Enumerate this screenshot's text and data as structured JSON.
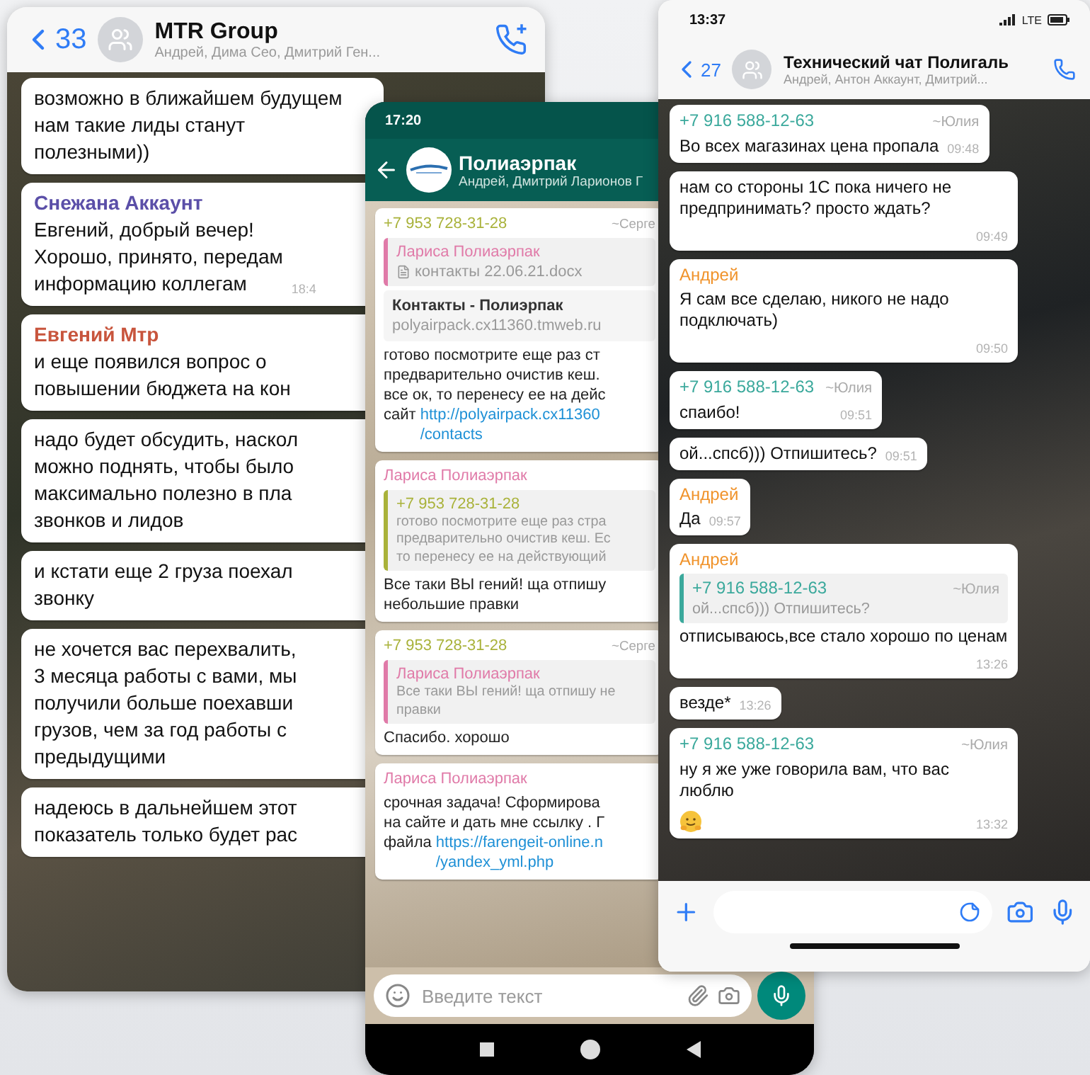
{
  "mtr_chat": {
    "back_count": "33",
    "title": "MTR Group",
    "subtitle": "Андрей, Дима Сео, Дмитрий Ген...",
    "messages": [
      {
        "lines": [
          "возможно в ближайшем будущем",
          "нам  такие лиды станут",
          "полезными))"
        ]
      },
      {
        "sender": "Снежана Аккаунт",
        "color": "#5b4fa8",
        "lines": [
          "Евгений, добрый вечер!",
          "Хорошо, принято, передам",
          "информацию коллегам"
        ],
        "time": "18:4"
      },
      {
        "sender": "Евгений Мтр",
        "color": "#c8553d",
        "lines": [
          "и еще появился вопрос о",
          "повышении бюджета на кон"
        ]
      },
      {
        "lines": [
          "надо будет обсудить, наскол",
          "можно поднять, чтобы было",
          "максимально полезно в пла",
          "звонков и лидов"
        ]
      },
      {
        "lines": [
          "и кстати еще 2 груза поехал",
          "звонку"
        ]
      },
      {
        "lines": [
          "не хочется вас перехвалить,",
          "3 месяца работы с вами, мы",
          "получили больше поехавши",
          "грузов, чем за год работы с",
          "предыдущими"
        ]
      },
      {
        "lines": [
          "надеюсь в дальнейшем этот",
          "показатель только будет рас"
        ]
      }
    ]
  },
  "poliaerpak_chat": {
    "status_time": "17:20",
    "title": "Полиаэрпак",
    "subtitle": "Андрей, Дмитрий Ларионов Г",
    "messages": [
      {
        "sender": "+7 953 728-31-28",
        "color": "#a9b23a",
        "author": "~Серге",
        "quote": {
          "sender": "Лариса Полиаэрпак",
          "color": "#e07aa8",
          "attachment": "контакты 22.06.21.docx"
        },
        "preview": {
          "title": "Контакты - Полиэрпак",
          "url": "polyairpack.cx11360.tmweb.ru"
        },
        "lines": [
          "готово посмотрите еще раз ст",
          "предварительно очистив кеш.",
          "все ок, то перенесу ее на дейс",
          "сайт"
        ],
        "link_lines": [
          "http://polyairpack.cx11360",
          "/contacts"
        ]
      },
      {
        "sender": "Лариса Полиаэрпак",
        "color": "#e07aa8",
        "quote": {
          "sender": "+7 953 728-31-28",
          "color": "#a9b23a",
          "lines": [
            "готово посмотрите еще раз стра",
            "предварительно очистив кеш. Ес",
            "то перенесу ее на действующий"
          ]
        },
        "lines": [
          "Все таки ВЫ гений! ща отпишу",
          "небольшие правки"
        ]
      },
      {
        "sender": "+7 953 728-31-28",
        "color": "#a9b23a",
        "author": "~Серге",
        "quote": {
          "sender": "Лариса Полиаэрпак",
          "color": "#e07aa8",
          "lines": [
            "Все таки ВЫ гений! ща отпишу не",
            "правки"
          ]
        },
        "lines": [
          "Спасибо. хорошо"
        ]
      },
      {
        "sender": "Лариса Полиаэрпак",
        "color": "#e07aa8",
        "lines": [
          "срочная задача!  Сформирова",
          "на сайте и дать мне ссылку . Г",
          "файла"
        ],
        "link_lines": [
          "https://farengeit-online.n",
          "/yandex_yml.php"
        ]
      }
    ],
    "input_placeholder": "Введите текст"
  },
  "poligal_chat": {
    "status_time": "13:37",
    "network": "LTE",
    "back_count": "27",
    "title": "Технический чат Полигаль",
    "subtitle": "Андрей, Антон Аккаунт, Дмитрий...",
    "messages": [
      {
        "sender": "+7 916 588-12-63",
        "color": "#3ba99c",
        "author": "~Юлия",
        "text": "Во всех магазинах цена пропала",
        "time": "09:48",
        "emoji": false
      },
      {
        "text": "нам со стороны 1С пока ничего не предпринимать? просто ждать?",
        "time": "09:49",
        "emoji": false
      },
      {
        "sender": "Андрей",
        "color": "#f0932b",
        "text": "Я сам все сделаю, никого не надо подключать)",
        "time": "09:50",
        "emoji": false
      },
      {
        "sender": "+7 916 588-12-63",
        "color": "#3ba99c",
        "author": "~Юлия",
        "text": "спаибо!",
        "time": "09:51",
        "emoji": false
      },
      {
        "text": "ой...спсб))) Отпишитесь?",
        "time": "09:51",
        "emoji": false
      },
      {
        "sender": "Андрей",
        "color": "#f0932b",
        "text": "Да",
        "time": "09:57",
        "emoji": false
      },
      {
        "sender": "Андрей",
        "color": "#f0932b",
        "quote": {
          "sender": "+7 916 588-12-63",
          "color": "#3ba99c",
          "author": "~Юлия",
          "text": "ой...спсб))) Отпишитесь?"
        },
        "text": "отписываюсь,все стало хорошо по ценам",
        "time": "13:26",
        "emoji": false
      },
      {
        "text": "везде*",
        "time": "13:26",
        "emoji": false
      },
      {
        "sender": "+7 916 588-12-63",
        "color": "#3ba99c",
        "author": "~Юлия",
        "text": "ну я же уже говорила вам, что вас люблю",
        "time": "13:32",
        "emoji": true
      }
    ]
  }
}
